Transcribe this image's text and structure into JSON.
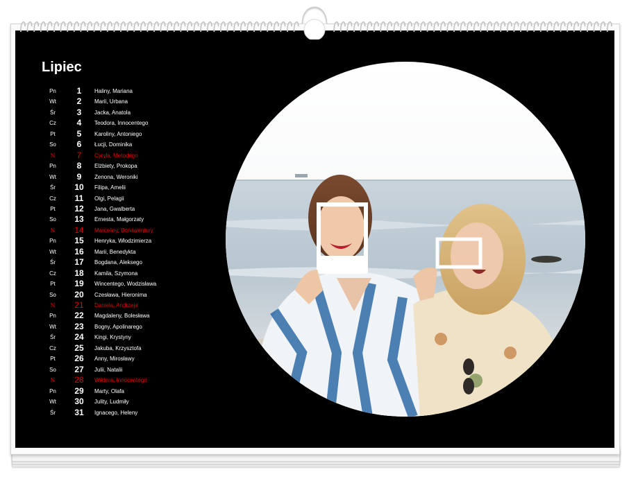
{
  "calendar": {
    "month": "Lipiec",
    "sunday_color": "#e00000",
    "days": [
      {
        "dow": "Pn",
        "num": "1",
        "names": "Haliny, Mariana",
        "sunday": false
      },
      {
        "dow": "Wt",
        "num": "2",
        "names": "Marii, Urbana",
        "sunday": false
      },
      {
        "dow": "Śr",
        "num": "3",
        "names": "Jacka, Anatola",
        "sunday": false
      },
      {
        "dow": "Cz",
        "num": "4",
        "names": "Teodora, Innocentego",
        "sunday": false
      },
      {
        "dow": "Pt",
        "num": "5",
        "names": "Karoliny, Antoniego",
        "sunday": false
      },
      {
        "dow": "So",
        "num": "6",
        "names": "Łucji, Dominika",
        "sunday": false
      },
      {
        "dow": "N",
        "num": "7",
        "names": "Cyryla, Metodego",
        "sunday": true
      },
      {
        "dow": "Pn",
        "num": "8",
        "names": "Elżbiety, Prokopa",
        "sunday": false
      },
      {
        "dow": "Wt",
        "num": "9",
        "names": "Zenona, Weroniki",
        "sunday": false
      },
      {
        "dow": "Śr",
        "num": "10",
        "names": "Filipa, Amelii",
        "sunday": false
      },
      {
        "dow": "Cz",
        "num": "11",
        "names": "Olgi, Pelagii",
        "sunday": false
      },
      {
        "dow": "Pt",
        "num": "12",
        "names": "Jana, Gwalberta",
        "sunday": false
      },
      {
        "dow": "So",
        "num": "13",
        "names": "Ernesta, Małgorzaty",
        "sunday": false
      },
      {
        "dow": "N",
        "num": "14",
        "names": "Marceliny, Bonawentury",
        "sunday": true
      },
      {
        "dow": "Pn",
        "num": "15",
        "names": "Henryka, Włodzimierza",
        "sunday": false
      },
      {
        "dow": "Wt",
        "num": "16",
        "names": "Marii, Benedykta",
        "sunday": false
      },
      {
        "dow": "Śr",
        "num": "17",
        "names": "Bogdana, Aleksego",
        "sunday": false
      },
      {
        "dow": "Cz",
        "num": "18",
        "names": "Kamila, Szymona",
        "sunday": false
      },
      {
        "dow": "Pt",
        "num": "19",
        "names": "Wincentego, Wodzisława",
        "sunday": false
      },
      {
        "dow": "So",
        "num": "20",
        "names": "Czesława, Hieronima",
        "sunday": false
      },
      {
        "dow": "N",
        "num": "21",
        "names": "Daniela, Andrzeja",
        "sunday": true
      },
      {
        "dow": "Pn",
        "num": "22",
        "names": "Magdaleny, Bolesława",
        "sunday": false
      },
      {
        "dow": "Wt",
        "num": "23",
        "names": "Bogny, Apolinarego",
        "sunday": false
      },
      {
        "dow": "Śr",
        "num": "24",
        "names": "Kingi, Krystyny",
        "sunday": false
      },
      {
        "dow": "Cz",
        "num": "25",
        "names": "Jakuba, Krzysztofa",
        "sunday": false
      },
      {
        "dow": "Pt",
        "num": "26",
        "names": "Anny, Mirosławy",
        "sunday": false
      },
      {
        "dow": "So",
        "num": "27",
        "names": "Julii, Natalii",
        "sunday": false
      },
      {
        "dow": "N",
        "num": "28",
        "names": "Wiktora, Innocentego",
        "sunday": true
      },
      {
        "dow": "Pn",
        "num": "29",
        "names": "Marty, Olafa",
        "sunday": false
      },
      {
        "dow": "Wt",
        "num": "30",
        "names": "Julity, Ludmiły",
        "sunday": false
      },
      {
        "dow": "Śr",
        "num": "31",
        "names": "Ignacego, Heleny",
        "sunday": false
      }
    ]
  },
  "photo": {
    "icon": "beach-photo-two-women-with-paper-frames"
  }
}
